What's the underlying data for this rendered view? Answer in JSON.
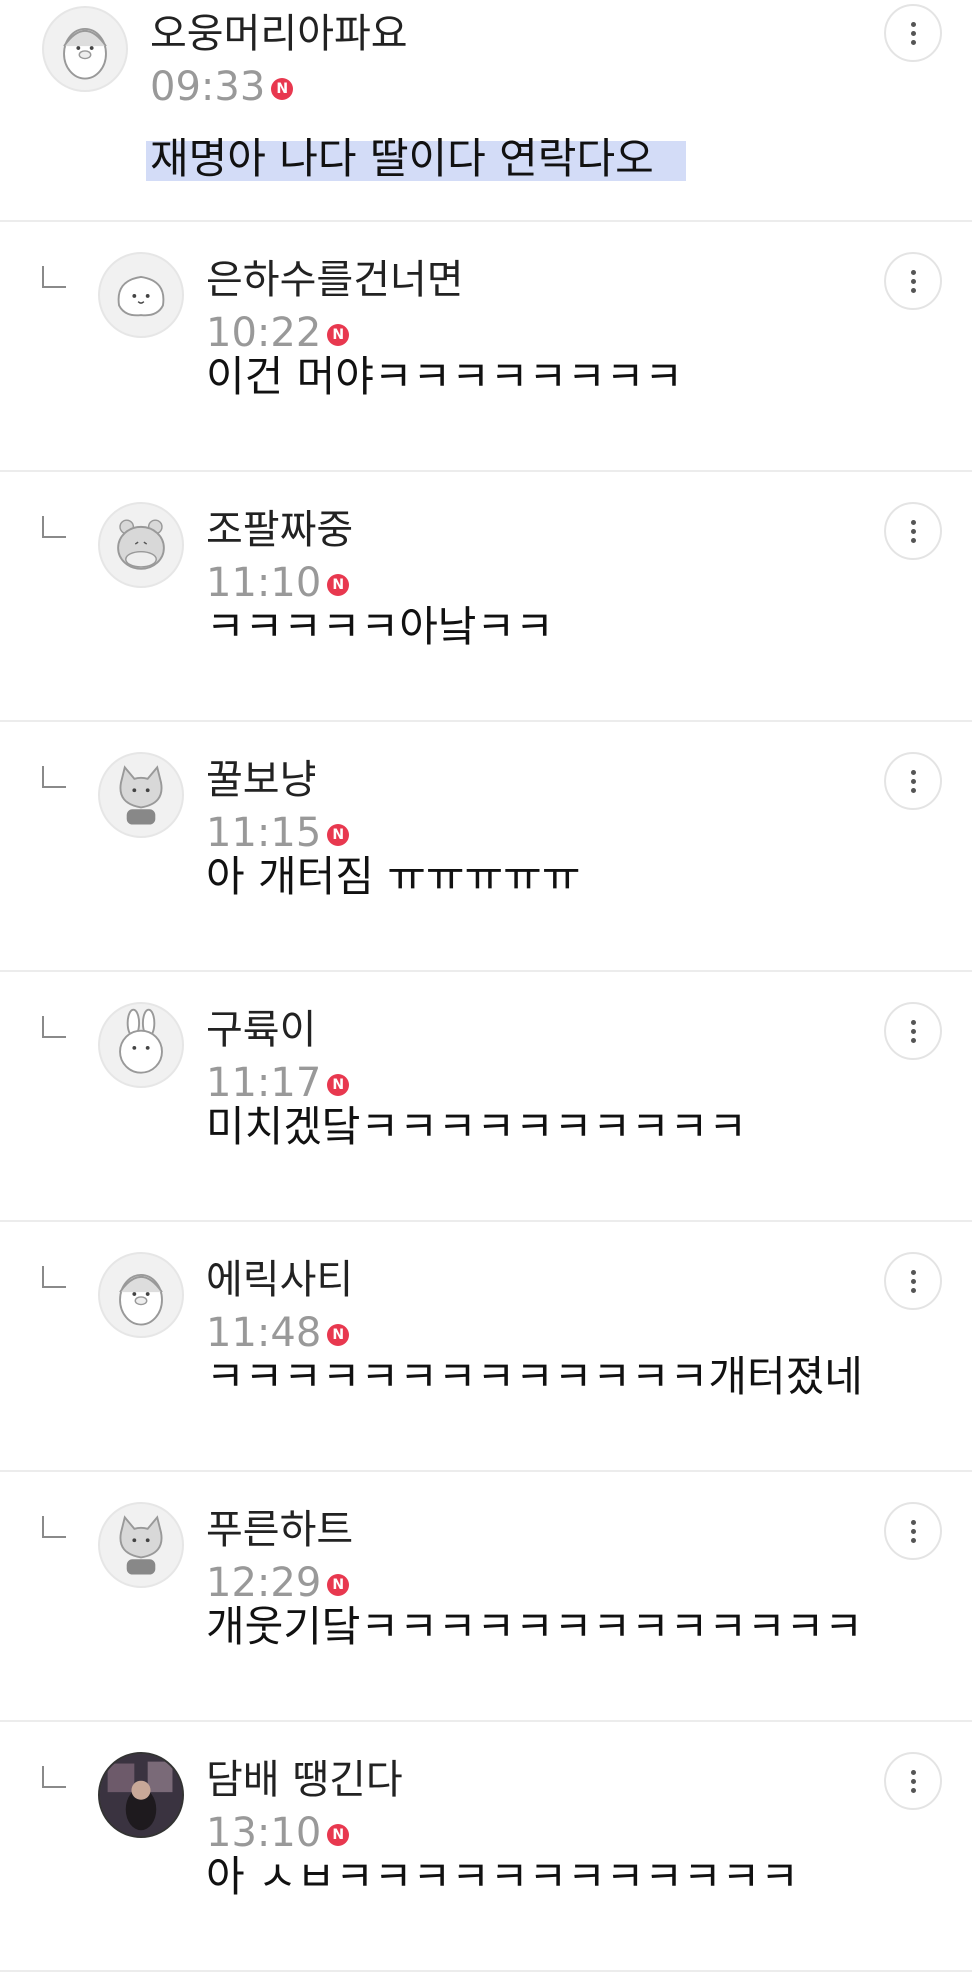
{
  "comments": [
    {
      "nick": "오웅머리아파요",
      "time": "09:33",
      "badge": "N",
      "text": "재명아 나다 딸이다 연락다오",
      "avatar": "penguin-avatar",
      "reply": false,
      "highlighted": true
    },
    {
      "nick": "은하수를건너면",
      "time": "10:22",
      "badge": "N",
      "text": "이건 머야ㅋㅋㅋㅋㅋㅋㅋㅋ",
      "avatar": "cloud-avatar",
      "reply": true
    },
    {
      "nick": "조팔짜중",
      "time": "11:10",
      "badge": "N",
      "text": "ㅋㅋㅋㅋㅋ아낰ㅋㅋ",
      "avatar": "bear-avatar",
      "reply": true
    },
    {
      "nick": "꿀보냥",
      "time": "11:15",
      "badge": "N",
      "text": "아 개터짐 ㅠㅠㅠㅠㅠ",
      "avatar": "cat-avatar",
      "reply": true
    },
    {
      "nick": "구륙이",
      "time": "11:17",
      "badge": "N",
      "text": "미치겠닼ㅋㅋㅋㅋㅋㅋㅋㅋㅋㅋ",
      "avatar": "rabbit-avatar",
      "reply": true
    },
    {
      "nick": "에릭사티",
      "time": "11:48",
      "badge": "N",
      "text": "ㅋㅋㅋㅋㅋㅋㅋㅋㅋㅋㅋㅋㅋ개터졌네",
      "avatar": "penguin-avatar",
      "reply": true
    },
    {
      "nick": "푸른하트",
      "time": "12:29",
      "badge": "N",
      "text": "개웃기닼ㅋㅋㅋㅋㅋㅋㅋㅋㅋㅋㅋㅋㅋ",
      "avatar": "cat-avatar",
      "reply": true
    },
    {
      "nick": "담배 땡긴다",
      "time": "13:10",
      "badge": "N",
      "text": "아 ㅅㅂㅋㅋㅋㅋㅋㅋㅋㅋㅋㅋㅋㅋ",
      "avatar": "photo-avatar",
      "reply": true
    }
  ]
}
